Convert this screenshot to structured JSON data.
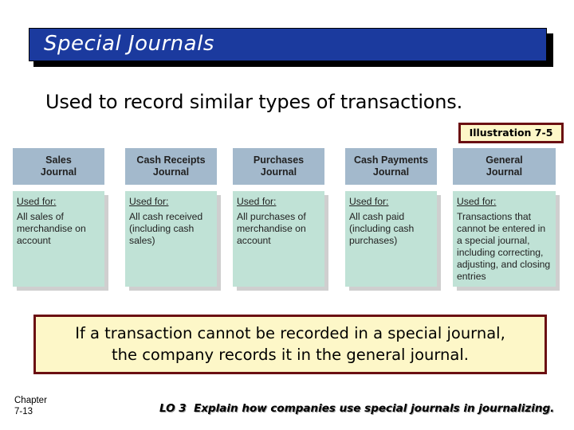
{
  "title": "Special Journals",
  "subtitle": "Used to record similar types of transactions.",
  "illustration_label": "Illustration 7-5",
  "journals": [
    {
      "name": "Sales Journal",
      "line1": "Sales",
      "line2": "Journal",
      "used_for_label": "Used for:",
      "description": "All sales of merchandise on account"
    },
    {
      "name": "Cash Receipts Journal",
      "line1": "Cash Receipts",
      "line2": "Journal",
      "used_for_label": "Used for:",
      "description": "All cash received (including cash sales)"
    },
    {
      "name": "Purchases Journal",
      "line1": "Purchases",
      "line2": "Journal",
      "used_for_label": "Used for:",
      "description": "All purchases of merchandise on account"
    },
    {
      "name": "Cash Payments Journal",
      "line1": "Cash Payments",
      "line2": "Journal",
      "used_for_label": "Used for:",
      "description": "All cash paid (including cash purchases)"
    },
    {
      "name": "General Journal",
      "line1": "General",
      "line2": "Journal",
      "used_for_label": "Used for:",
      "description": "Transactions that cannot be entered in a special journal, including correcting, adjusting, and closing entries"
    }
  ],
  "note": {
    "line1": "If a transaction cannot be recorded in a special journal,",
    "line2": "the company records it in the general journal."
  },
  "footer": {
    "chapter_label": "Chapter",
    "page": "7-13",
    "lo": "LO 3  Explain how companies use special journals in journalizing."
  },
  "colors": {
    "title_bg": "#1b3a9e",
    "header_bg": "#a3b9cc",
    "body_bg": "#c0e2d6",
    "note_bg": "#fdf7c8",
    "note_border": "#6b0f12"
  }
}
